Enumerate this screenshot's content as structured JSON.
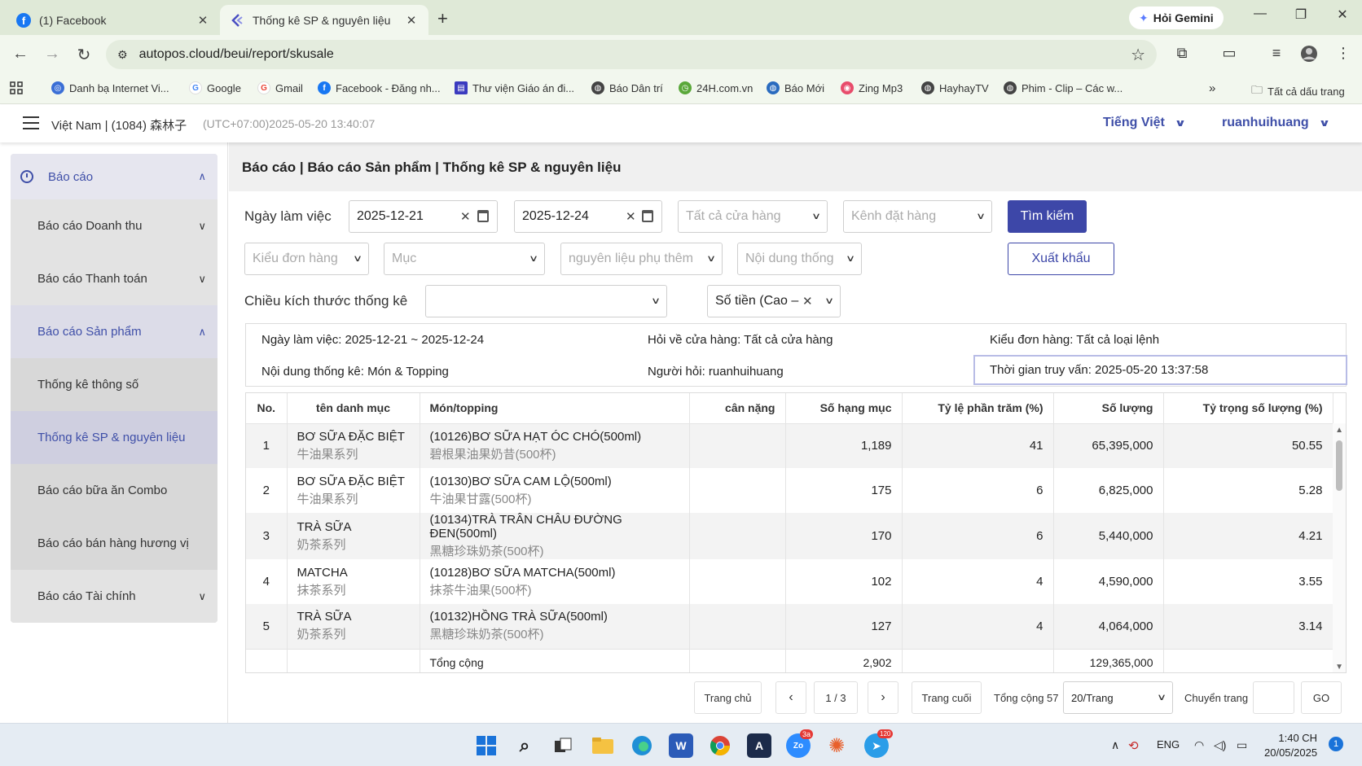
{
  "browser": {
    "tabs": [
      {
        "title": "(1) Facebook",
        "active": false
      },
      {
        "title": "Thống kê SP & nguyên liệu",
        "active": true
      }
    ],
    "gemini_label": "Hỏi Gemini",
    "url": "autopos.cloud/beui/report/skusale",
    "bookmarks": [
      "Danh bạ Internet Vi...",
      "Google",
      "Gmail",
      "Facebook - Đăng nh...",
      "Thư viện Giáo án đi...",
      "Báo Dân trí",
      "24H.com.vn",
      "Báo Mới",
      "Zing Mp3",
      "HayhayTV",
      "Phim - Clip – Các w..."
    ],
    "all_bookmarks": "Tất cả dấu trang"
  },
  "header": {
    "store": "Việt Nam | (1084) 森林子",
    "time": "(UTC+07:00)2025-05-20 13:40:07",
    "language": "Tiếng Việt",
    "user": "ruanhuihuang"
  },
  "sidebar": {
    "top": "Báo cáo",
    "items": [
      {
        "label": "Báo cáo Doanh thu",
        "kind": "group"
      },
      {
        "label": "Báo cáo Thanh toán",
        "kind": "group"
      },
      {
        "label": "Báo cáo Sản phẩm",
        "kind": "group-open"
      },
      {
        "label": "Thống kê thông số",
        "kind": "sub"
      },
      {
        "label": "Thống kê SP & nguyên liệu",
        "kind": "sub-active"
      },
      {
        "label": "Báo cáo bữa ăn Combo",
        "kind": "sub"
      },
      {
        "label": "Báo cáo bán hàng hương vị",
        "kind": "sub"
      },
      {
        "label": "Báo cáo Tài chính",
        "kind": "group"
      }
    ]
  },
  "breadcrumb": "Báo cáo | Báo cáo Sản phẩm | Thống kê SP & nguyên liệu",
  "filters": {
    "work_day_label": "Ngày làm việc",
    "date_from": "2025-12-21",
    "date_to": "2025-12-24",
    "store_placeholder": "Tất cả cửa hàng",
    "channel_placeholder": "Kênh đặt hàng",
    "search_button": "Tìm kiếm",
    "order_type_placeholder": "Kiểu đơn hàng",
    "category_placeholder": "Mục",
    "ingredient_placeholder": "nguyên liệu phụ thêm",
    "content_placeholder": "Nội dung thống",
    "export_button": "Xuất khẩu",
    "dimension_label": "Chiều kích thước thống kê",
    "dimension_value": "",
    "sort_value": "Số tiền (Cao –"
  },
  "summary": {
    "work_day": "Ngày làm việc:  2025-12-21 ~ 2025-12-24",
    "store": "Hỏi về cửa hàng:  Tất cả cửa hàng",
    "order_type": "Kiểu đơn hàng:  Tất cả loại lệnh",
    "content": "Nội dung thống kê:  Món & Topping",
    "asker": "Người hỏi: ruanhuihuang",
    "query_time": "Thời gian truy vấn: 2025-05-20 13:37:58"
  },
  "table": {
    "headers": [
      "No.",
      "tên danh mục",
      "Món/topping",
      "cân nặng",
      "Số hạng mục",
      "Tỷ lệ phần trăm (%)",
      "Số lượng",
      "Tỷ trọng số lượng (%)"
    ],
    "rows": [
      {
        "no": "1",
        "cat": "BƠ SỮA ĐẶC BIỆT",
        "cat_zh": "牛油果系列",
        "item": "(10126)BƠ SỮA HẠT ÓC CHÓ(500ml)",
        "item_zh": "碧根果油果奶昔(500杯)",
        "weight": "",
        "count": "1,189",
        "pct": "41",
        "qty": "65,395,000",
        "qty_pct": "50.55"
      },
      {
        "no": "2",
        "cat": "BƠ SỮA ĐẶC BIỆT",
        "cat_zh": "牛油果系列",
        "item": "(10130)BƠ SỮA CAM LỘ(500ml)",
        "item_zh": "牛油果甘露(500杯)",
        "weight": "",
        "count": "175",
        "pct": "6",
        "qty": "6,825,000",
        "qty_pct": "5.28"
      },
      {
        "no": "3",
        "cat": "TRÀ SỮA",
        "cat_zh": "奶茶系列",
        "item": "(10134)TRÀ TRÂN CHÂU ĐƯỜNG ĐEN(500ml)",
        "item_zh": "黑糖珍珠奶茶(500杯)",
        "weight": "",
        "count": "170",
        "pct": "6",
        "qty": "5,440,000",
        "qty_pct": "4.21"
      },
      {
        "no": "4",
        "cat": "MATCHA",
        "cat_zh": "抹茶系列",
        "item": "(10128)BƠ SỮA MATCHA(500ml)",
        "item_zh": "抹茶牛油果(500杯)",
        "weight": "",
        "count": "102",
        "pct": "4",
        "qty": "4,590,000",
        "qty_pct": "3.55"
      },
      {
        "no": "5",
        "cat": "TRÀ SỮA",
        "cat_zh": "奶茶系列",
        "item": "(10132)HỒNG TRÀ SỮA(500ml)",
        "item_zh": "黑糖珍珠奶茶(500杯)",
        "weight": "",
        "count": "127",
        "pct": "4",
        "qty": "4,064,000",
        "qty_pct": "3.14"
      }
    ],
    "total": {
      "label": "Tổng cộng",
      "count": "2,902",
      "qty": "129,365,000"
    }
  },
  "pagination": {
    "first": "Trang chủ",
    "prev": "‹",
    "page": "1 / 3",
    "next": "›",
    "last": "Trang cuối",
    "total": "Tổng cộng 57",
    "per_page": "20/Trang",
    "goto_label": "Chuyển trang",
    "goto_value": "",
    "go": "GO"
  },
  "taskbar": {
    "lang": "ENG",
    "time": "1:40 CH",
    "date": "20/05/2025",
    "notif": "1",
    "zoom_badge": "3a",
    "zalo_badge": "120"
  },
  "colors": {
    "primary": "#3d47a8",
    "tab_bg": "#dfe9d7",
    "sidebar_active": "#cfcfe0"
  }
}
